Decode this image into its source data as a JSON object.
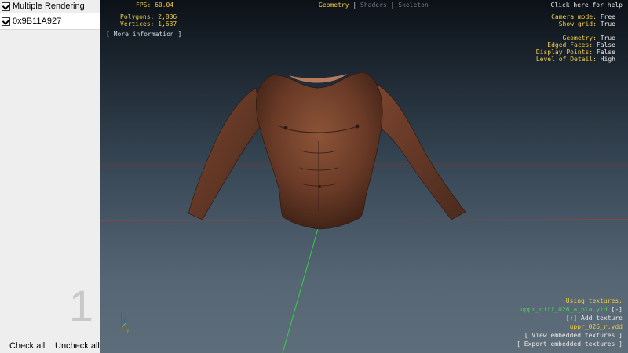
{
  "left_panel": {
    "multiple_rendering_label": "Multiple Rendering",
    "list_items": [
      "0x9B11A927"
    ],
    "counter": "1",
    "check_all_label": "Check all",
    "uncheck_all_label": "Uncheck all"
  },
  "hud": {
    "fps_label": "FPS: 60.04",
    "polygons_label": "Polygons: 2,836",
    "vertices_label": "Vertices: 1,637",
    "more_info_label": "[ More information ]",
    "tabs": [
      "Geometry",
      "Shaders",
      "Skeleton"
    ],
    "help_label": "Click here for help",
    "camera_mode_key": "Camera mode:",
    "camera_mode_val": "Free",
    "show_grid_key": "Show grid:",
    "show_grid_val": "True",
    "geometry_key": "Geometry:",
    "geometry_val": "True",
    "edged_faces_key": "Edged Faces:",
    "edged_faces_val": "False",
    "display_points_key": "Display Points:",
    "display_points_val": "False",
    "lod_key": "Level of Detail:",
    "lod_val": "High",
    "using_textures_label": "Using textures:",
    "texture_file": "uppr_diff_026_a_bla.ytd",
    "texture_file_toggle": "[-]",
    "add_texture_label": "[+] Add texture",
    "model_file": "uppr_026_r.ydd",
    "view_embedded_label": "[ View embedded textures ]",
    "export_embedded_label": "[ Export embedded textures ]"
  },
  "axes": {
    "x": "x",
    "y": "y",
    "z": "z"
  },
  "colors": {
    "hud_yellow": "#f2cc45",
    "hud_green": "#4fd25a",
    "hud_white": "#e8e8e8",
    "axis_red": "#b83a3a",
    "axis_green": "#2fd33d",
    "skin_mid": "#7a4530"
  }
}
